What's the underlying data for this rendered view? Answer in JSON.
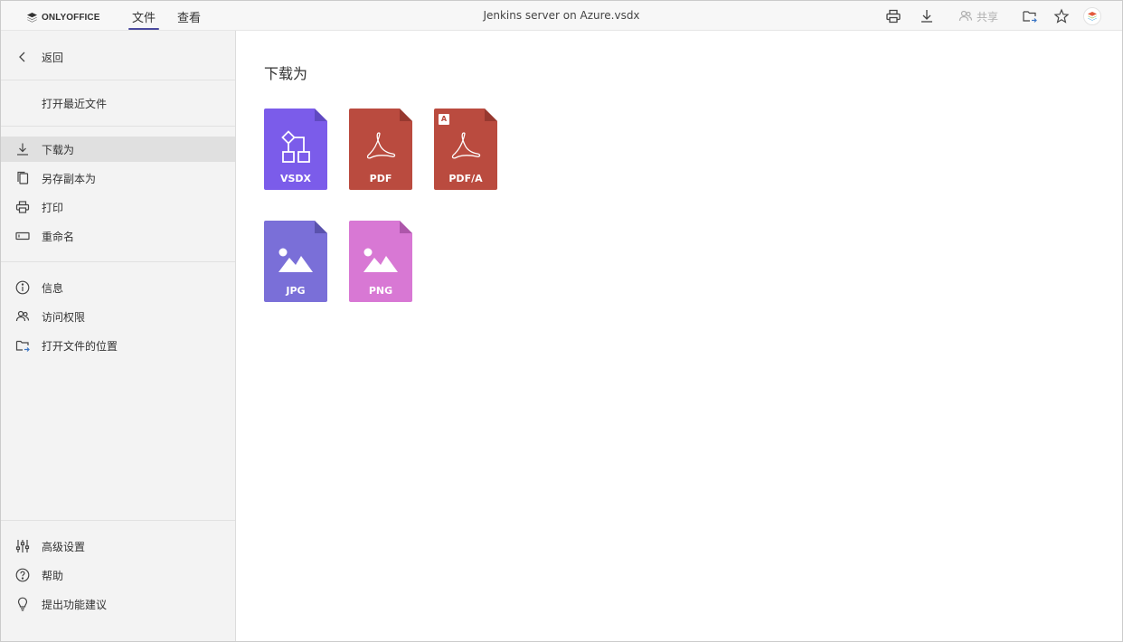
{
  "app": {
    "logo_text": "ONLYOFFICE",
    "doc_title": "Jenkins server on Azure.vsdx"
  },
  "menu": {
    "tabs": [
      {
        "label": "文件",
        "active": true
      },
      {
        "label": "查看",
        "active": false
      }
    ]
  },
  "toolbar": {
    "print_icon": "printer-icon",
    "download_icon": "download-icon",
    "share_label": "共享",
    "open_location_icon": "folder-arrow-icon",
    "favorite_icon": "star-icon"
  },
  "sidebar": {
    "back": "返回",
    "recent": "打开最近文件",
    "download_as": "下载为",
    "save_copy": "另存副本为",
    "print": "打印",
    "rename": "重命名",
    "info": "信息",
    "access": "访问权限",
    "open_location": "打开文件的位置",
    "advanced": "高级设置",
    "help": "帮助",
    "suggest": "提出功能建议"
  },
  "main": {
    "title": "下载为",
    "formats": [
      {
        "label": "VSDX",
        "color": "#7b5cea",
        "icon": "diagram-icon"
      },
      {
        "label": "PDF",
        "color": "#ba4b3f",
        "icon": "acrobat-icon"
      },
      {
        "label": "PDF/A",
        "color": "#ba4b3f",
        "icon": "acrobat-icon",
        "badge": "A"
      },
      {
        "label": "JPG",
        "color": "#7a6fd8",
        "icon": "image-icon"
      },
      {
        "label": "PNG",
        "color": "#d878d4",
        "icon": "image-icon"
      }
    ]
  }
}
